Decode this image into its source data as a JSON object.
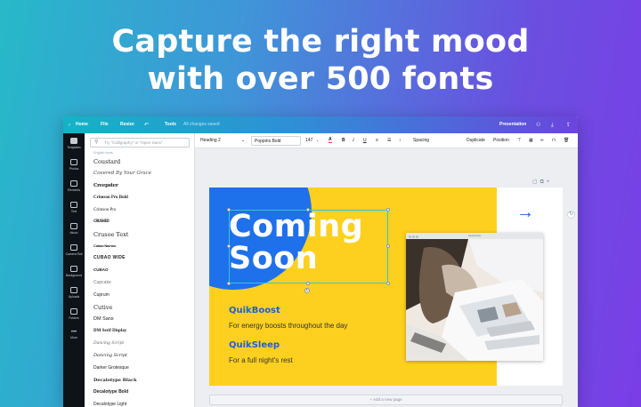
{
  "headline": {
    "line1": "Capture the right mood",
    "line2": "with over 500 fonts"
  },
  "menubar": {
    "home": "Home",
    "file": "File",
    "resize": "Resize",
    "tools": "Tools",
    "saved": "All changes saved",
    "presentation": "Presentation",
    "icons": [
      "back-chevron-icon",
      "undo-icon",
      "share-icon",
      "download-icon",
      "upload-icon"
    ]
  },
  "rail": {
    "items": [
      "Templates",
      "Photos",
      "Elements",
      "Text",
      "Music",
      "Camera Roll",
      "Background",
      "Uploads",
      "Folders",
      "More"
    ]
  },
  "panel": {
    "search_placeholder": "Try \"Calligraphy\" or \"Open Sans\"",
    "section_label": "English fonts",
    "fonts": [
      "Coustard",
      "Covered By Your Grace",
      "Creepster",
      "Crimson Pro Bold",
      "Crimson Pro",
      "CRUSHED",
      "Crusoe Text",
      "Cubao Narrow",
      "CUBAO WIDE",
      "CUBAO",
      "Cupcake",
      "Cuprum",
      "Cutive",
      "DM Sans",
      "DM Serif Display",
      "Dancing Script",
      "Dancing Script",
      "Darker Grotesque",
      "Decalotype Black",
      "Decalotype Bold",
      "Decalotype Light"
    ]
  },
  "toolbar": {
    "text_style": "Heading 2",
    "font_name": "Poppins Bold",
    "font_size": "147",
    "spacing": "Spacing",
    "duplicate": "Duplicate",
    "position": "Position"
  },
  "slide": {
    "title_line1": "Coming",
    "title_line2": "Soon",
    "product1_name": "QuikBoost",
    "product1_desc": "For energy boosts throughout the day",
    "product2_name": "QuikSleep",
    "product2_desc": "For a full night's rest",
    "browser_url": "canva.com",
    "colors": {
      "yellow": "#fdd01f",
      "blue": "#1f70eb"
    }
  },
  "canvas": {
    "add_page": "+ Add a new page"
  }
}
